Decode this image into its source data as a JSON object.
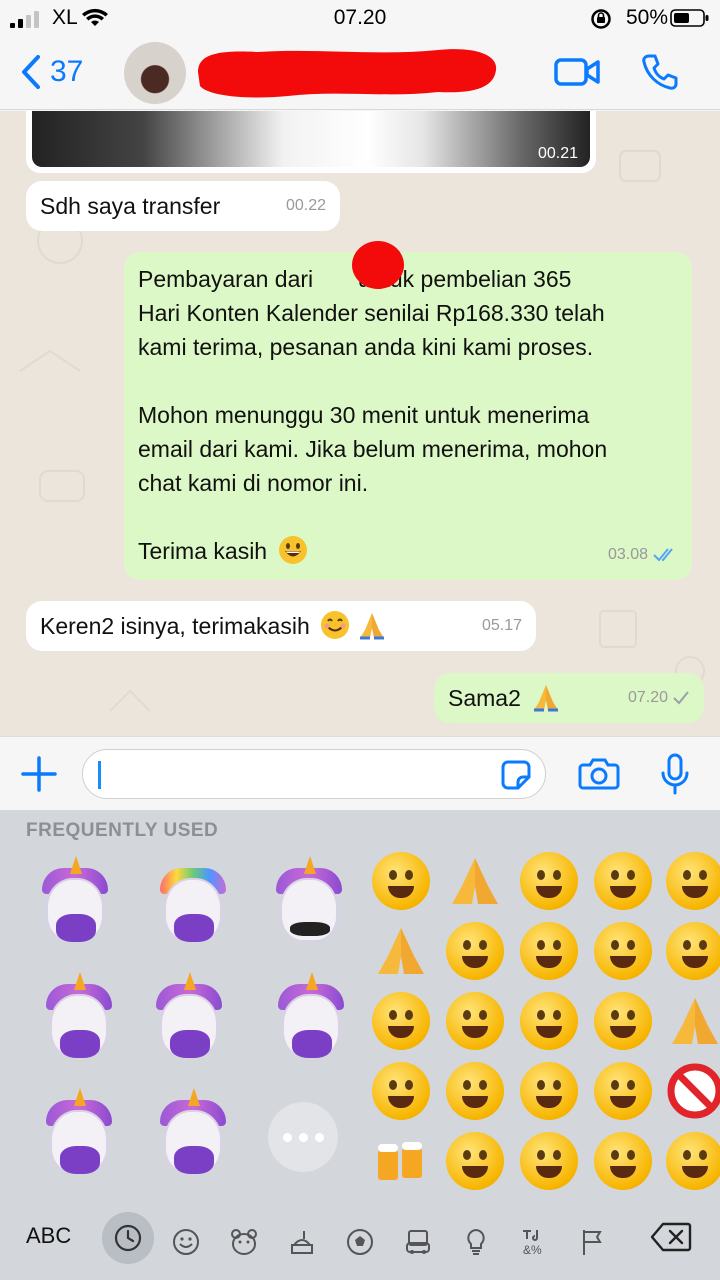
{
  "status_bar": {
    "carrier": "XL",
    "time": "07.20",
    "battery": "50%"
  },
  "header": {
    "back_count": "37"
  },
  "chat": {
    "video_time": "00.21",
    "messages": [
      {
        "dir": "in",
        "text": "Sdh saya transfer",
        "time": "00.22"
      },
      {
        "dir": "out",
        "lines": [
          "Pembayaran dari       untuk pembelian 365",
          "Hari Konten Kalender senilai Rp168.330 telah",
          "kami terima, pesanan anda kini kami proses.",
          "Mohon menunggu 30 menit untuk menerima",
          "email dari kami. Jika belum menerima, mohon",
          "chat kami di nomor ini.",
          "Terima kasih"
        ],
        "time": "03.08"
      },
      {
        "dir": "in",
        "text": "Keren2 isinya, terimakasih",
        "time": "05.17"
      },
      {
        "dir": "out",
        "text": "Sama2",
        "time": "07.20"
      }
    ]
  },
  "input": {
    "value": ""
  },
  "keyboard": {
    "section_title": "FREQUENTLY USED",
    "abc_label": "ABC",
    "memoji": [
      "sleeping-unicorn-memoji",
      "mind-blown-unicorn-memoji",
      "swearing-unicorn-memoji",
      "heart-eyes-unicorn-memoji",
      "kiss-unicorn-memoji",
      "tongue-out-unicorn-memoji",
      "star-struck-unicorn-memoji",
      "tears-of-joy-unicorn-memoji"
    ],
    "emoji": [
      "rofl",
      "thumbs-up",
      "kissing",
      "thinking",
      "smiling",
      "folded-hands",
      "downcast-sweat",
      "grinning",
      "grinning-big-eyes",
      "smiling-hearts",
      "beaming",
      "screaming",
      "sunglasses",
      "grin",
      "pointing-down",
      "crying-loud",
      "heart-eyes",
      "squinting-tongue",
      "tears-of-joy",
      "prohibited",
      "clinking-beer",
      "relieved",
      "sad-sweat",
      "squinting-laugh",
      "grinning-sweat"
    ]
  },
  "colors": {
    "accent": "#0a7aff",
    "bubble_out": "#dcf8c6",
    "bubble_in": "#ffffff",
    "chat_bg": "#ece5dc",
    "redaction": "#f30a0a"
  }
}
